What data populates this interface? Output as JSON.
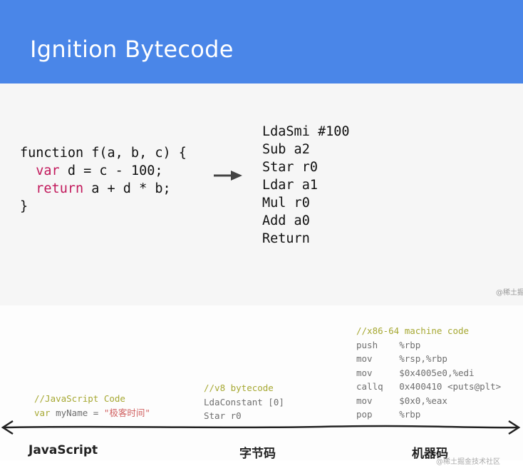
{
  "slide": {
    "title": "Ignition Bytecode",
    "js_code": {
      "line1": "function f(a, b, c) {",
      "line2_kw": "var",
      "line2_rest": " d = c - 100;",
      "line3_kw": "return",
      "line3_rest": " a + d * b;",
      "line4": "}"
    },
    "bytecode": [
      "LdaSmi #100",
      "Sub a2",
      "Star r0",
      "Ldar a1",
      "Mul r0",
      "Add a0",
      "Return"
    ],
    "watermark": "@稀土掘"
  },
  "pipeline": {
    "javascript": {
      "comment": "//JavaScript Code",
      "kw": "var",
      "name": " myName = ",
      "value": "\"极客时间\"",
      "label": "JavaScript"
    },
    "bytecode": {
      "comment": "//v8 bytecode",
      "line1": "LdaConstant [0]",
      "line2": "Star r0",
      "label": "字节码"
    },
    "machine": {
      "comment": "//x86-64 machine code",
      "lines": [
        [
          "push",
          "%rbp"
        ],
        [
          "mov",
          "%rsp,%rbp"
        ],
        [
          "mov",
          "$0x4005e0,%edi"
        ],
        [
          "callq",
          "0x400410 <puts@plt>"
        ],
        [
          "mov",
          "$0x0,%eax"
        ],
        [
          "pop",
          "%rbp"
        ]
      ],
      "label": "机器码"
    },
    "watermark": "@稀土掘金技术社区"
  },
  "colors": {
    "header": "#4a86e8",
    "keyword": "#c2185b",
    "comment": "#a6a832"
  }
}
